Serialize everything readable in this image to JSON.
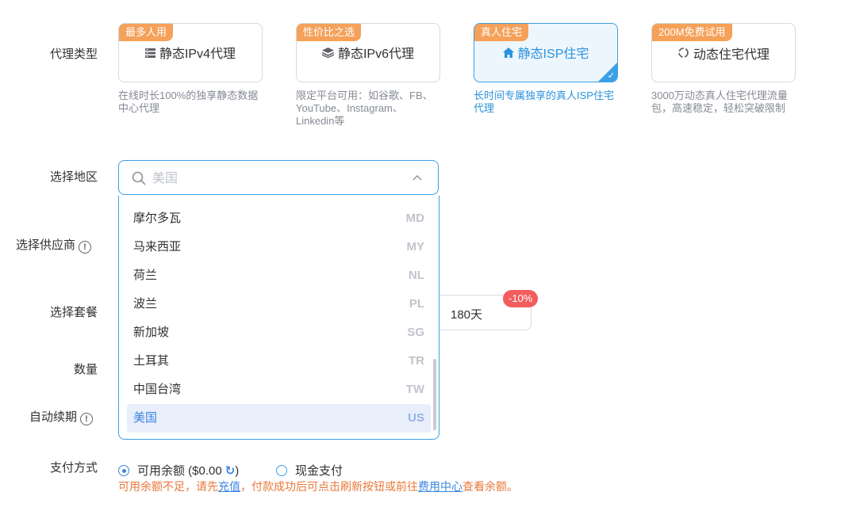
{
  "labels": {
    "proxy_type": "代理类型",
    "region": "选择地区",
    "provider": "选择供应商",
    "package": "选择套餐",
    "quantity": "数量",
    "auto_renew": "自动续期",
    "payment": "支付方式",
    "info_mark": "!"
  },
  "proxy_cards": [
    {
      "badge": "最多人用",
      "title": "静态IPv4代理",
      "icon": "server-icon",
      "desc": "在线时长100%的独享静态数据中心代理",
      "active": false
    },
    {
      "badge": "性价比之选",
      "title": "静态IPv6代理",
      "icon": "layers-icon",
      "desc": "限定平台可用：如谷歌、FB、YouTube、Instagram、Linkedin等",
      "active": false
    },
    {
      "badge": "真人住宅",
      "title": "静态ISP住宅",
      "icon": "home-icon",
      "desc": "长时间专属独享的真人ISP住宅代理",
      "active": true
    },
    {
      "badge": "200M免费试用",
      "title": "动态住宅代理",
      "icon": "cycle-icon",
      "desc": "3000万动态真人住宅代理流量包，高速稳定，轻松突破限制",
      "active": false
    }
  ],
  "region_select": {
    "placeholder": "美国",
    "options": [
      {
        "name": "摩尔多瓦",
        "code": "MD"
      },
      {
        "name": "马来西亚",
        "code": "MY"
      },
      {
        "name": "荷兰",
        "code": "NL"
      },
      {
        "name": "波兰",
        "code": "PL"
      },
      {
        "name": "新加坡",
        "code": "SG"
      },
      {
        "name": "土耳其",
        "code": "TR"
      },
      {
        "name": "中国台湾",
        "code": "TW"
      },
      {
        "name": "美国",
        "code": "US",
        "selected": true
      }
    ]
  },
  "package": {
    "day_option": "180天",
    "discount": "-10%"
  },
  "payment": {
    "balance_label": "可用余额 ($0.00",
    "balance_close": ")",
    "refresh_icon": "↻",
    "cash_label": "现金支付",
    "warning_prefix": "可用余额不足，请先",
    "recharge_link": "充值",
    "warning_middle": "，付款成功后可点击刷新按钮或前往",
    "fee_center_link": "费用中心",
    "warning_suffix": "查看余额。"
  },
  "colors": {
    "accent": "#3aa0e4",
    "badge_orange": "#f5a15a",
    "discount_red": "#f25d5d",
    "warning_orange": "#e8773a"
  }
}
